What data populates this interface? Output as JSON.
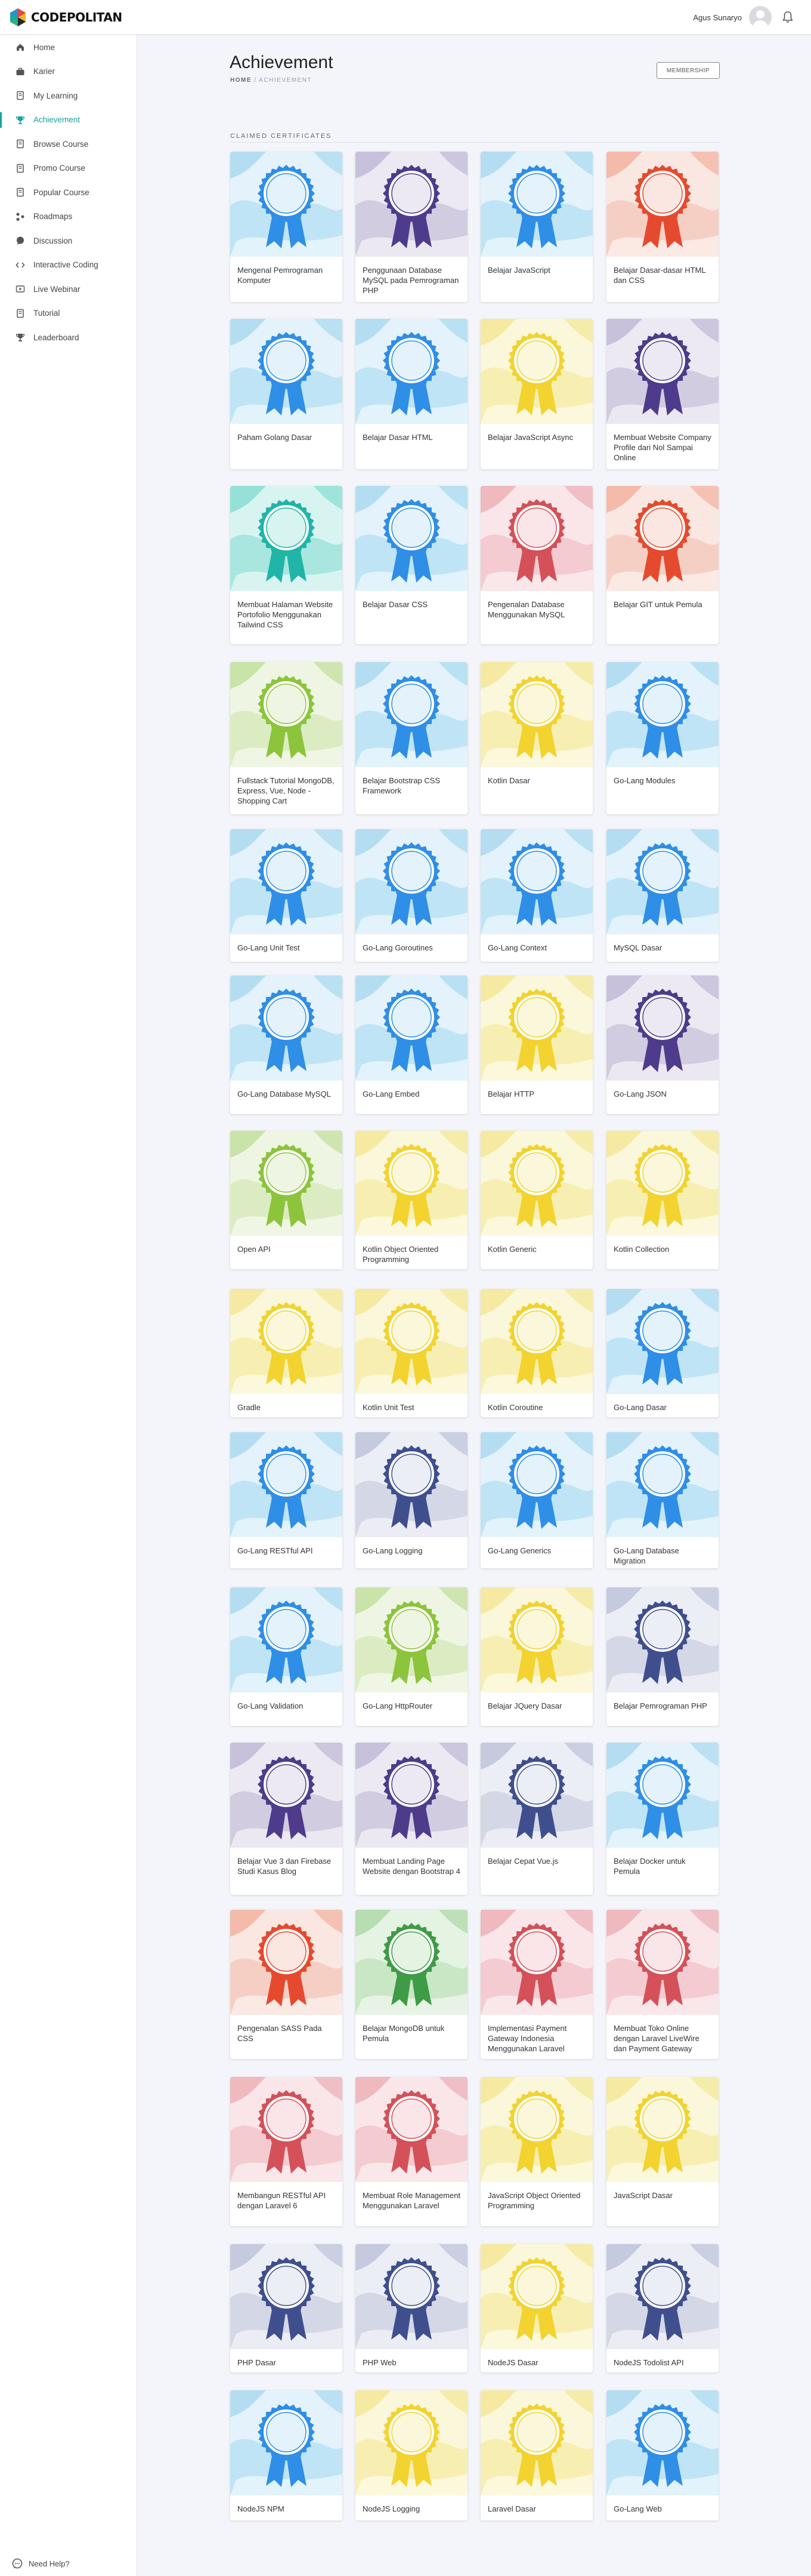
{
  "brand": {
    "name": "CODEPOLITAN",
    "accent": "#17a2a2"
  },
  "user": {
    "name": "Agus Sunaryo"
  },
  "sidebar": {
    "items": [
      {
        "label": "Home",
        "icon": "home-icon"
      },
      {
        "label": "Karier",
        "icon": "briefcase-icon"
      },
      {
        "label": "My Learning",
        "icon": "book-icon"
      },
      {
        "label": "Achievement",
        "icon": "trophy-icon",
        "active": true
      },
      {
        "label": "Browse Course",
        "icon": "book-icon"
      },
      {
        "label": "Promo Course",
        "icon": "book-icon"
      },
      {
        "label": "Popular Course",
        "icon": "book-icon"
      },
      {
        "label": "Roadmaps",
        "icon": "roadmap-icon"
      },
      {
        "label": "Discussion",
        "icon": "chat-icon"
      },
      {
        "label": "Interactive Coding",
        "icon": "code-icon"
      },
      {
        "label": "Live Webinar",
        "icon": "video-icon"
      },
      {
        "label": "Tutorial",
        "icon": "book-icon"
      },
      {
        "label": "Leaderboard",
        "icon": "trophy-icon"
      }
    ],
    "help_label": "Need Help?"
  },
  "page": {
    "title": "Achievement",
    "breadcrumb_home": "HOME",
    "breadcrumb_sep": "/",
    "breadcrumb_current": "ACHIEVEMENT",
    "membership_label": "MEMBERSHIP",
    "section_title": "CLAIMED CERTIFICATES"
  },
  "colors": {
    "blue": "#2f8ee6",
    "purple": "#4e3b8c",
    "red": "#e64a2e",
    "yellow": "#f2d32f",
    "teal": "#20b5a6",
    "green": "#8cc43c",
    "navy": "#3f4f8e",
    "crimson": "#d4515a",
    "darkgreen": "#3e9b46"
  },
  "certificates": [
    {
      "name": "Mengenal Pemrograman Komputer",
      "color": "blue"
    },
    {
      "name": "Penggunaan Database MySQL pada Pemrograman PHP",
      "color": "purple"
    },
    {
      "name": "Belajar JavaScript",
      "color": "blue"
    },
    {
      "name": "Belajar Dasar-dasar HTML dan CSS",
      "color": "red"
    },
    {
      "name": "Paham Golang Dasar",
      "color": "blue"
    },
    {
      "name": "Belajar Dasar HTML",
      "color": "blue"
    },
    {
      "name": "Belajar JavaScript Async",
      "color": "yellow"
    },
    {
      "name": "Membuat Website Company Profile dari Nol Sampai Online",
      "color": "purple"
    },
    {
      "name": "Membuat Halaman Website Portofolio Menggunakan Tailwind CSS",
      "color": "teal"
    },
    {
      "name": "Belajar Dasar CSS",
      "color": "blue"
    },
    {
      "name": "Pengenalan Database Menggunakan MySQL",
      "color": "crimson"
    },
    {
      "name": "Belajar GIT untuk Pemula",
      "color": "red"
    },
    {
      "name": "Fullstack Tutorial MongoDB, Express, Vue, Node - Shopping Cart",
      "color": "green"
    },
    {
      "name": "Belajar Bootstrap CSS Framework",
      "color": "blue"
    },
    {
      "name": "Kotlin Dasar",
      "color": "yellow"
    },
    {
      "name": "Go-Lang Modules",
      "color": "blue"
    },
    {
      "name": "Go-Lang Unit Test",
      "color": "blue"
    },
    {
      "name": "Go-Lang Goroutines",
      "color": "blue"
    },
    {
      "name": "Go-Lang Context",
      "color": "blue"
    },
    {
      "name": "MySQL Dasar",
      "color": "blue"
    },
    {
      "name": "Go-Lang Database MySQL",
      "color": "blue"
    },
    {
      "name": "Go-Lang Embed",
      "color": "blue"
    },
    {
      "name": "Belajar HTTP",
      "color": "yellow"
    },
    {
      "name": "Go-Lang JSON",
      "color": "purple"
    },
    {
      "name": "Open API",
      "color": "green"
    },
    {
      "name": "Kotlin Object Oriented Programming",
      "color": "yellow"
    },
    {
      "name": "Kotlin Generic",
      "color": "yellow"
    },
    {
      "name": "Kotlin Collection",
      "color": "yellow"
    },
    {
      "name": "Gradle",
      "color": "yellow"
    },
    {
      "name": "Kotlin Unit Test",
      "color": "yellow"
    },
    {
      "name": "Kotlin Coroutine",
      "color": "yellow"
    },
    {
      "name": "Go-Lang Dasar",
      "color": "blue"
    },
    {
      "name": "Go-Lang RESTful API",
      "color": "blue"
    },
    {
      "name": "Go-Lang Logging",
      "color": "navy"
    },
    {
      "name": "Go-Lang Generics",
      "color": "blue"
    },
    {
      "name": "Go-Lang Database Migration",
      "color": "blue"
    },
    {
      "name": "Go-Lang Validation",
      "color": "blue"
    },
    {
      "name": "Go-Lang HttpRouter",
      "color": "green"
    },
    {
      "name": "Belajar JQuery Dasar",
      "color": "yellow"
    },
    {
      "name": "Belajar Pemrograman PHP",
      "color": "navy"
    },
    {
      "name": "Belajar Vue 3 dan Firebase Studi Kasus Blog",
      "color": "purple"
    },
    {
      "name": "Membuat Landing Page Website dengan Bootstrap 4",
      "color": "purple"
    },
    {
      "name": "Belajar Cepat Vue.js",
      "color": "navy"
    },
    {
      "name": "Belajar Docker untuk Pemula",
      "color": "blue"
    },
    {
      "name": "Pengenalan SASS Pada CSS",
      "color": "red"
    },
    {
      "name": "Belajar MongoDB untuk Pemula",
      "color": "darkgreen"
    },
    {
      "name": "Implementasi Payment Gateway Indonesia Menggunakan Laravel",
      "color": "crimson"
    },
    {
      "name": "Membuat Toko Online dengan Laravel LiveWire dan Payment Gateway",
      "color": "crimson"
    },
    {
      "name": "Membangun RESTful API dengan Laravel 6",
      "color": "crimson"
    },
    {
      "name": "Membuat Role Management Menggunakan Laravel",
      "color": "crimson"
    },
    {
      "name": "JavaScript Object Oriented Programming",
      "color": "yellow"
    },
    {
      "name": "JavaScript Dasar",
      "color": "yellow"
    },
    {
      "name": "PHP Dasar",
      "color": "navy"
    },
    {
      "name": "PHP Web",
      "color": "navy"
    },
    {
      "name": "NodeJS Dasar",
      "color": "yellow"
    },
    {
      "name": "NodeJS Todolist API",
      "color": "navy"
    },
    {
      "name": "NodeJS NPM",
      "color": "blue"
    },
    {
      "name": "NodeJS Logging",
      "color": "yellow"
    },
    {
      "name": "Laravel Dasar",
      "color": "yellow"
    },
    {
      "name": "Go-Lang Web",
      "color": "blue"
    }
  ]
}
